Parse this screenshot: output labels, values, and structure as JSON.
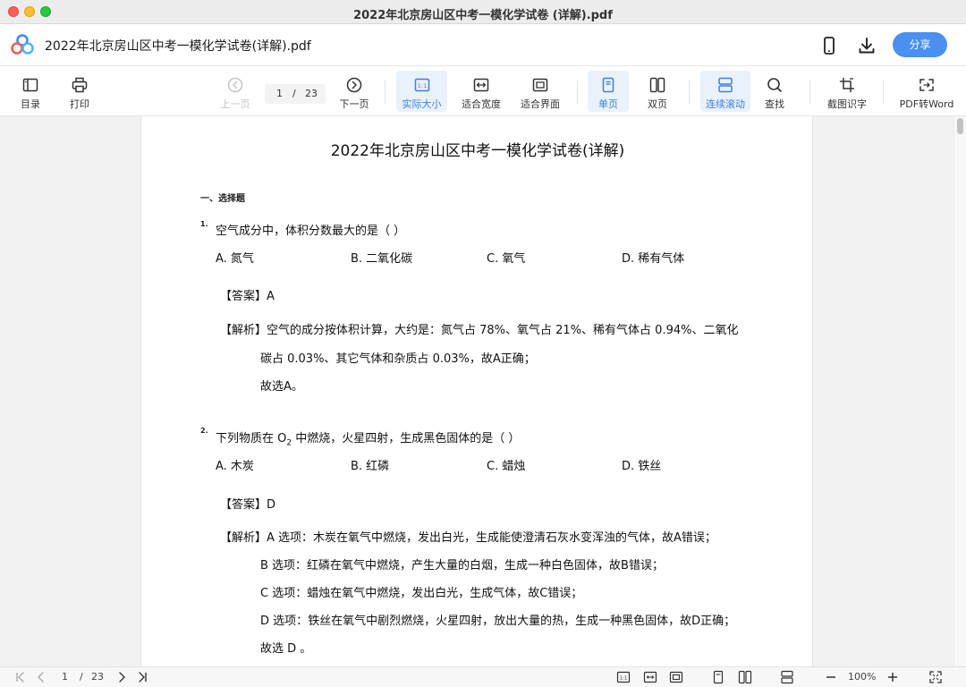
{
  "window": {
    "title": "2022年北京房山区中考一模化学试卷 (详解).pdf"
  },
  "header": {
    "doc_title": "2022年北京房山区中考一模化学试卷(详解).pdf",
    "share_label": "分享",
    "icons": [
      "phone-icon",
      "download-icon"
    ]
  },
  "toolbar": {
    "toc": "目录",
    "print": "打印",
    "prev": "上一页",
    "current_page": "1",
    "page_sep": "/",
    "total_pages": "23",
    "next": "下一页",
    "actual_size": "实际大小",
    "fit_width": "适合宽度",
    "fit_screen": "适合界面",
    "single_page": "单页",
    "double_page": "双页",
    "continuous": "连续滚动",
    "find": "查找",
    "ocr": "截图识字",
    "to_word": "PDF转Word"
  },
  "page": {
    "title": "2022年北京房山区中考一模化学试卷(详解)",
    "section": "一、选择题",
    "q1": {
      "num": "1.",
      "text": "空气成分中，体积分数最大的是（    ）",
      "options": [
        "A. 氮气",
        "B. 二氧化碳",
        "C. 氧气",
        "D. 稀有气体"
      ],
      "answer": "【答案】A",
      "analysis": [
        "【解析】空气的成分按体积计算，大约是：氮气占 78%、氧气占 21%、稀有气体占 0.94%、二氧化",
        "碳占 0.03%、其它气体和杂质占 0.03%，故A正确；",
        "故选A。"
      ]
    },
    "q2": {
      "num": "2.",
      "text_pre": "下列物质在 O",
      "text_sub": "2",
      "text_post": " 中燃烧，火星四射，生成黑色固体的是（    ）",
      "options": [
        "A. 木炭",
        "B. 红磷",
        "C. 蜡烛",
        "D. 铁丝"
      ],
      "answer": "【答案】D",
      "analysis": [
        "【解析】A 选项：木炭在氧气中燃烧，发出白光，生成能使澄清石灰水变浑浊的气体，故A错误；",
        "B 选项：红磷在氧气中燃烧，产生大量的白烟，生成一种白色固体，故B错误；",
        "C 选项：蜡烛在氧气中燃烧，发出白光，生成气体，故C错误；",
        "D 选项：铁丝在氧气中剧烈燃烧，火星四射，放出大量的热，生成一种黑色固体，故D正确；",
        "故选 D 。"
      ]
    }
  },
  "status": {
    "current_page": "1",
    "page_sep": "/",
    "total_pages": "23",
    "zoom": "100%"
  },
  "colors": {
    "accent": "#4a90f0",
    "active_bg": "#e9f1fc",
    "active_text": "#3d7fe0"
  }
}
